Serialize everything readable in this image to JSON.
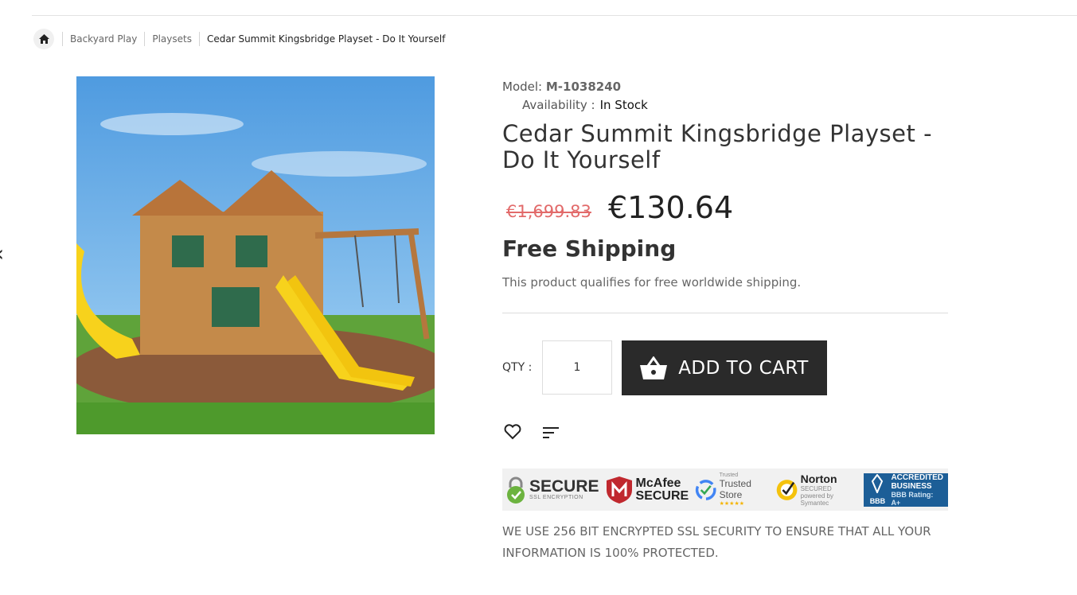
{
  "breadcrumb": {
    "items": [
      "Backyard Play",
      "Playsets",
      "Cedar Summit Kingsbridge Playset - Do It Yourself"
    ]
  },
  "product": {
    "model_label": "Model:",
    "model_value": "M-1038240",
    "availability_label": "Availability :",
    "availability_value": "In Stock",
    "title": "Cedar Summit Kingsbridge Playset - Do It Yourself",
    "old_price": "€1,699.83",
    "price": "€130.64",
    "shipping_title": "Free Shipping",
    "shipping_note": "This product qualifies for free worldwide shipping."
  },
  "purchase": {
    "qty_label": "QTY :",
    "qty_value": "1",
    "add_to_cart": "ADD TO CART"
  },
  "trust": {
    "secure": "SECURE",
    "secure_sub": "SSL ENCRYPTION",
    "mcafee_1": "McAfee",
    "mcafee_2": "SECURE",
    "trusted_top": "Trusted",
    "trusted": "Trusted Store",
    "stars": "★★★★★",
    "norton": "Norton",
    "norton_sub": "SECURED",
    "norton_by": "powered by Symantec",
    "bbb": "BBB",
    "bbb_1": "ACCREDITED",
    "bbb_2": "BUSINESS",
    "bbb_rating": "BBB Rating: A+"
  },
  "ssl_note": "WE USE 256 BIT ENCRYPTED SSL SECURITY TO ENSURE THAT ALL YOUR INFORMATION IS 100% PROTECTED.",
  "colors": {
    "cart_bg": "#2a2a2a",
    "old_price": "#e26a6a",
    "bbb": "#1c5e97"
  }
}
